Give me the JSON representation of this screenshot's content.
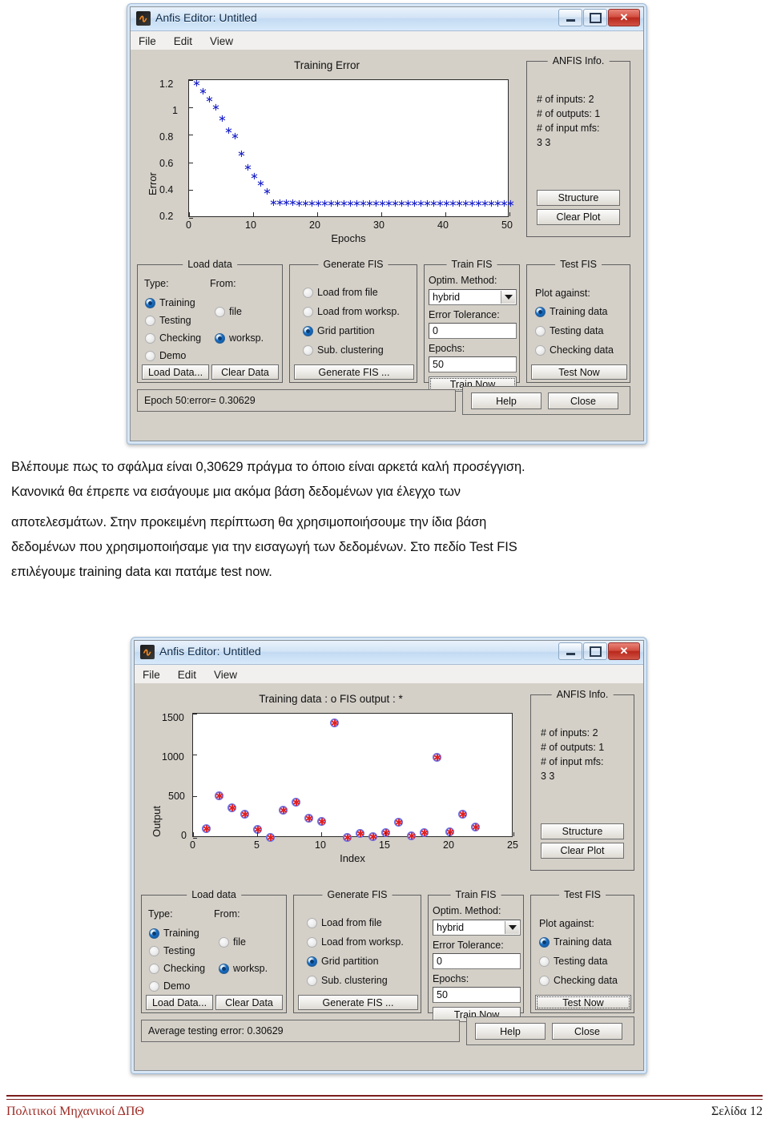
{
  "window1": {
    "title": "Anfis Editor: Untitled",
    "icon": "matlab-icon",
    "menus": [
      "File",
      "Edit",
      "View"
    ],
    "controls": {
      "minimize": "minimize-icon",
      "maximize": "maximize-icon",
      "close": "✕"
    },
    "anfis_info": {
      "legend": "ANFIS Info.",
      "lines": [
        "# of inputs: 2",
        "# of outputs: 1",
        "# of input mfs:",
        "3  3"
      ],
      "structure_button": "Structure",
      "clear_plot_button": "Clear Plot"
    },
    "load_data": {
      "legend": "Load data",
      "type_label": "Type:",
      "from_label": "From:",
      "types": [
        {
          "label": "Training",
          "selected": true
        },
        {
          "label": "Testing",
          "selected": false
        },
        {
          "label": "Checking",
          "selected": false
        },
        {
          "label": "Demo",
          "selected": false
        }
      ],
      "froms": [
        {
          "label": "file",
          "selected": false
        },
        {
          "label": "worksp.",
          "selected": true
        }
      ],
      "load_button": "Load Data...",
      "clear_button": "Clear Data"
    },
    "generate_fis": {
      "legend": "Generate FIS",
      "options": [
        {
          "label": "Load from file",
          "selected": false
        },
        {
          "label": "Load from worksp.",
          "selected": false
        },
        {
          "label": "Grid partition",
          "selected": true
        },
        {
          "label": "Sub. clustering",
          "selected": false
        }
      ],
      "button": "Generate FIS ..."
    },
    "train_fis": {
      "legend": "Train FIS",
      "optim_label": "Optim. Method:",
      "optim_value": "hybrid",
      "tolerance_label": "Error Tolerance:",
      "tolerance_value": "0",
      "epochs_label": "Epochs:",
      "epochs_value": "50",
      "button": "Train Now",
      "button_focused": true
    },
    "test_fis": {
      "legend": "Test FIS",
      "plot_against_label": "Plot against:",
      "options": [
        {
          "label": "Training data",
          "selected": true
        },
        {
          "label": "Testing data",
          "selected": false
        },
        {
          "label": "Checking data",
          "selected": false
        }
      ],
      "button": "Test Now",
      "button_focused": false
    },
    "status": "Epoch 50:error= 0.30629",
    "help_button": "Help",
    "close_button": "Close"
  },
  "window2": {
    "title": "Anfis Editor: Untitled",
    "icon": "matlab-icon",
    "menus": [
      "File",
      "Edit",
      "View"
    ],
    "controls": {
      "minimize": "minimize-icon",
      "maximize": "maximize-icon",
      "close": "✕"
    },
    "anfis_info": {
      "legend": "ANFIS Info.",
      "lines": [
        "# of inputs: 2",
        "# of outputs: 1",
        "# of input mfs:",
        "3  3"
      ],
      "structure_button": "Structure",
      "clear_plot_button": "Clear Plot"
    },
    "load_data": {
      "legend": "Load data",
      "type_label": "Type:",
      "from_label": "From:",
      "types": [
        {
          "label": "Training",
          "selected": true
        },
        {
          "label": "Testing",
          "selected": false
        },
        {
          "label": "Checking",
          "selected": false
        },
        {
          "label": "Demo",
          "selected": false
        }
      ],
      "froms": [
        {
          "label": "file",
          "selected": false
        },
        {
          "label": "worksp.",
          "selected": true
        }
      ],
      "load_button": "Load Data...",
      "clear_button": "Clear Data"
    },
    "generate_fis": {
      "legend": "Generate FIS",
      "options": [
        {
          "label": "Load from file",
          "selected": false
        },
        {
          "label": "Load from worksp.",
          "selected": false
        },
        {
          "label": "Grid partition",
          "selected": true
        },
        {
          "label": "Sub. clustering",
          "selected": false
        }
      ],
      "button": "Generate FIS ..."
    },
    "train_fis": {
      "legend": "Train FIS",
      "optim_label": "Optim. Method:",
      "optim_value": "hybrid",
      "tolerance_label": "Error Tolerance:",
      "tolerance_value": "0",
      "epochs_label": "Epochs:",
      "epochs_value": "50",
      "button": "Train Now",
      "button_focused": false
    },
    "test_fis": {
      "legend": "Test FIS",
      "plot_against_label": "Plot against:",
      "options": [
        {
          "label": "Training data",
          "selected": true
        },
        {
          "label": "Testing data",
          "selected": false
        },
        {
          "label": "Checking data",
          "selected": false
        }
      ],
      "button": "Test Now",
      "button_focused": true
    },
    "status": "Average testing error: 0.30629",
    "help_button": "Help",
    "close_button": "Close"
  },
  "paragraph": {
    "lines": [
      "Βλέπουμε πως το σφάλμα είναι 0,30629 πράγμα το όποιο είναι αρκετά καλή προσέγγιση.",
      "Κανονικά θα έπρεπε να εισάγουμε μια ακόμα βάση δεδομένων για έλεγχο των",
      "αποτελεσμάτων. Στην προκειμένη περίπτωση θα χρησιμοποιήσουμε την ίδια βάση",
      "δεδομένων που χρησιμοποιήσαμε για την εισαγωγή  των δεδομένων. Στο πεδίο Test FIS",
      "επιλέγουμε training data και πατάμε test now."
    ]
  },
  "footer": {
    "left": "Πολιτικοί Μηχανικοί ΔΠΘ",
    "right": "Σελίδα 12"
  },
  "colors": {
    "dialog_face": "#d4d0c8",
    "marker_blue": "#1d24c9",
    "marker_red": "#e02020",
    "marker_ring": "#6f6fe0",
    "footer_rule": "#7b1c1c",
    "footer_left_text": "#9c2a24",
    "close_button": "#b9281c"
  },
  "chart_data": [
    {
      "type": "scatter",
      "title": "Training Error",
      "xlabel": "Epochs",
      "ylabel": "Error",
      "xlim": [
        0,
        50
      ],
      "ylim": [
        0.2,
        1.2
      ],
      "xticks": [
        0,
        10,
        20,
        30,
        40,
        50
      ],
      "yticks": [
        0.2,
        0.4,
        0.6,
        0.8,
        1,
        1.2
      ],
      "grid": false,
      "legend": "none",
      "marker": "*",
      "marker_color": "#1d24c9",
      "x": [
        1,
        2,
        3,
        4,
        5,
        6,
        7,
        8,
        9,
        10,
        11,
        12,
        13,
        14,
        15,
        16,
        17,
        18,
        19,
        20,
        21,
        22,
        23,
        24,
        25,
        26,
        27,
        28,
        29,
        30,
        31,
        32,
        33,
        34,
        35,
        36,
        37,
        38,
        39,
        40,
        41,
        42,
        43,
        44,
        45,
        46,
        47,
        48,
        49,
        50
      ],
      "y": [
        1.175,
        1.12,
        1.06,
        1.0,
        0.92,
        0.835,
        0.795,
        0.665,
        0.565,
        0.5,
        0.45,
        0.39,
        0.311,
        0.309,
        0.308,
        0.308,
        0.307,
        0.307,
        0.307,
        0.307,
        0.307,
        0.307,
        0.307,
        0.307,
        0.307,
        0.307,
        0.307,
        0.307,
        0.307,
        0.307,
        0.307,
        0.307,
        0.307,
        0.307,
        0.307,
        0.307,
        0.307,
        0.307,
        0.307,
        0.307,
        0.307,
        0.307,
        0.307,
        0.307,
        0.307,
        0.307,
        0.307,
        0.307,
        0.307,
        0.306
      ]
    },
    {
      "type": "scatter",
      "title": "Training data : o   FIS output : *",
      "xlabel": "Index",
      "ylabel": "Output",
      "xlim": [
        0,
        25
      ],
      "ylim": [
        0,
        1500
      ],
      "xticks": [
        0,
        5,
        10,
        15,
        20,
        25
      ],
      "yticks": [
        0,
        500,
        1000,
        1500
      ],
      "grid": false,
      "legend": "in-title",
      "series": [
        {
          "name": "Training data",
          "marker": "o",
          "marker_color": "#6f6fe0",
          "x": [
            1,
            2,
            3,
            4,
            5,
            6,
            7,
            8,
            9,
            10,
            11,
            12,
            13,
            14,
            15,
            16,
            17,
            18,
            19,
            20,
            21,
            22
          ],
          "values": [
            110,
            510,
            360,
            290,
            100,
            5,
            330,
            430,
            240,
            195,
            1390,
            5,
            55,
            10,
            60,
            190,
            20,
            60,
            975,
            70,
            290,
            130
          ]
        },
        {
          "name": "FIS output",
          "marker": "*",
          "marker_color": "#e02020",
          "x": [
            1,
            2,
            3,
            4,
            5,
            6,
            7,
            8,
            9,
            10,
            11,
            12,
            13,
            14,
            15,
            16,
            17,
            18,
            19,
            20,
            21,
            22
          ],
          "values": [
            110,
            510,
            360,
            290,
            100,
            5,
            330,
            430,
            240,
            195,
            1390,
            5,
            55,
            10,
            60,
            190,
            20,
            60,
            975,
            70,
            290,
            130
          ]
        }
      ]
    }
  ]
}
